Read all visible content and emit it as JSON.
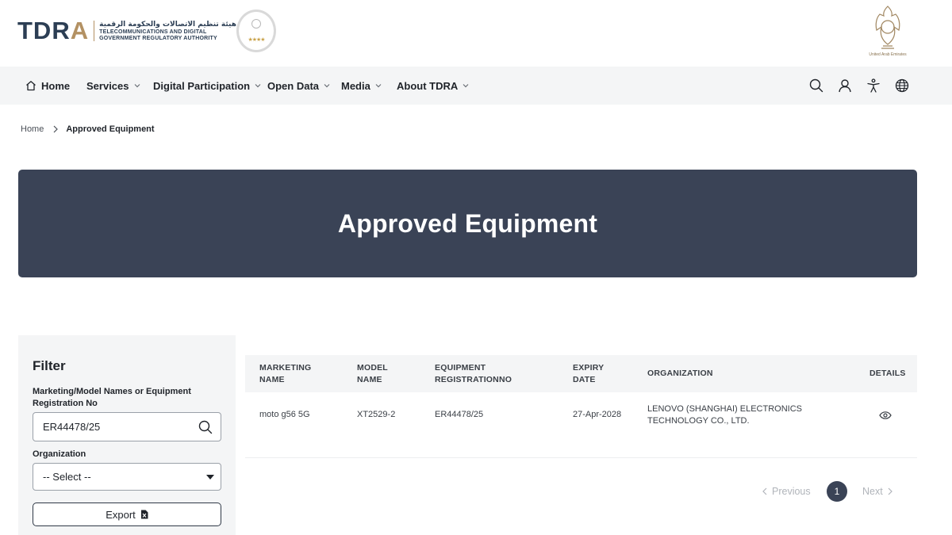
{
  "header": {
    "logo_word_left": "TDR",
    "logo_word_accent": "A",
    "logo_arabic": "هيئة تنظيم الاتصالات والحكومة الرقمية",
    "logo_english_line1": "TELECOMMUNICATIONS AND DIGITAL",
    "logo_english_line2": "GOVERNMENT REGULATORY AUTHORITY",
    "award_stars": "★★★★",
    "uae_caption": "United Arab Emirates"
  },
  "nav": {
    "items": [
      {
        "label": "Home"
      },
      {
        "label": "Services"
      },
      {
        "label": "Digital Participation"
      },
      {
        "label": "Open Data"
      },
      {
        "label": "Media"
      },
      {
        "label": "About TDRA"
      }
    ],
    "icons": [
      "search-icon",
      "user-icon",
      "accessibility-icon",
      "globe-icon"
    ]
  },
  "breadcrumb": {
    "home": "Home",
    "current": "Approved Equipment"
  },
  "banner": {
    "title": "Approved Equipment"
  },
  "filter": {
    "title": "Filter",
    "search_label": "Marketing/Model Names or Equipment Registration No",
    "search_value": "ER44478/25",
    "org_label": "Organization",
    "org_selected": "-- Select --",
    "export_label": "Export"
  },
  "table": {
    "headers": {
      "marketing_l1": "MARKETING",
      "marketing_l2": "NAME",
      "model_l1": "MODEL",
      "model_l2": "NAME",
      "equip_l1": "EQUIPMENT",
      "equip_l2": "REGISTRATIONNO",
      "expiry_l1": "EXPIRY",
      "expiry_l2": "DATE",
      "organization": "ORGANIZATION",
      "details": "DETAILS"
    },
    "rows": [
      {
        "marketing_name": "moto g56 5G",
        "model_name": "XT2529-2",
        "registration_no": "ER44478/25",
        "expiry_date": "27-Apr-2028",
        "org_l1": "LENOVO (SHANGHAI) ELECTRONICS",
        "org_l2": "TECHNOLOGY CO., LTD."
      }
    ]
  },
  "pagination": {
    "previous": "Previous",
    "current_page": "1",
    "next": "Next"
  },
  "colors": {
    "banner": "#3a4356",
    "panel": "#f4f5f6",
    "brand_gold": "#b39163",
    "brand_navy": "#2c3e54"
  }
}
